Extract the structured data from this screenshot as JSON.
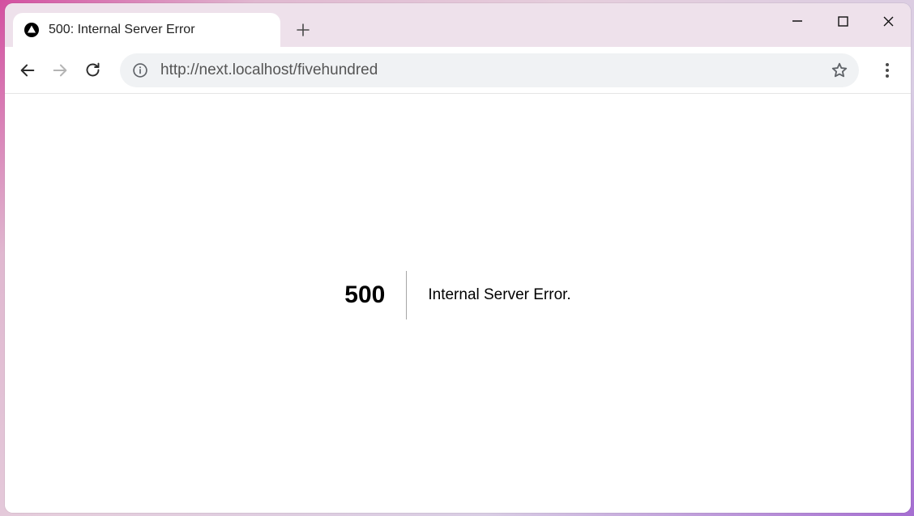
{
  "tab": {
    "title": "500: Internal Server Error"
  },
  "toolbar": {
    "url": "http://next.localhost/fivehundred"
  },
  "page": {
    "error_code": "500",
    "error_message": "Internal Server Error."
  }
}
